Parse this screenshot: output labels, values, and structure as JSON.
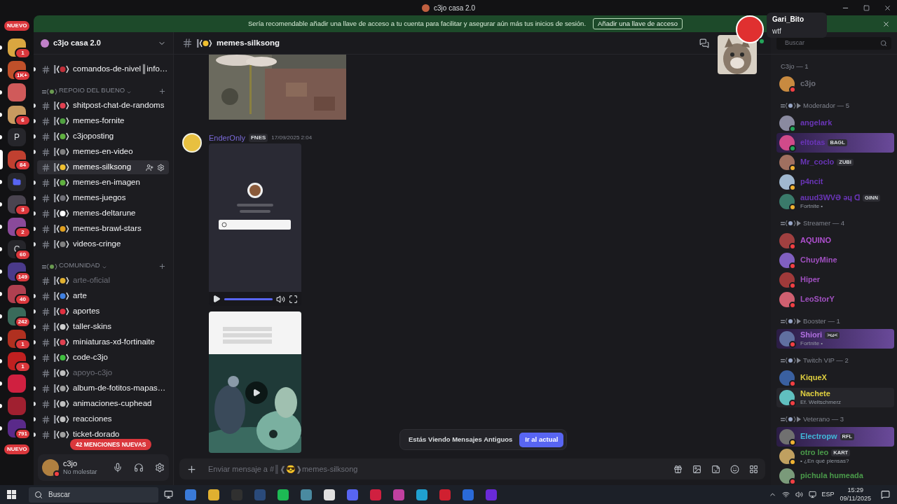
{
  "window": {
    "title": "c3jo casa 2.0"
  },
  "banner": {
    "text": "Sería recomendable añadir una llave de acceso a tu cuenta para facilitar y asegurar aún más tus inicios de sesión.",
    "action": "Añadir una llave de acceso"
  },
  "rail": {
    "top_pill": "NUEVO",
    "bottom_pill": "NUEVO",
    "servers": [
      {
        "kind": "icon",
        "color": "#d9a640",
        "badge": "1",
        "selected": false
      },
      {
        "kind": "icon",
        "color": "#c0502a",
        "badge": "1K+",
        "selected": false
      },
      {
        "kind": "icon",
        "color": "#d05a5a",
        "selected": false
      },
      {
        "kind": "icon",
        "color": "#c89a60",
        "badge": "6",
        "selected": false
      },
      {
        "kind": "letter",
        "letter": "P",
        "selected": false
      },
      {
        "kind": "icon",
        "color": "#c04030",
        "badge": "84",
        "selected": true
      },
      {
        "kind": "folder",
        "selected": false
      },
      {
        "kind": "icon",
        "color": "#4a4450",
        "badge": "3",
        "selected": false
      },
      {
        "kind": "icon",
        "color": "#8a4a9a",
        "badge": "2",
        "selected": false
      },
      {
        "kind": "letter",
        "letter": "C",
        "badge": "60",
        "selected": false
      },
      {
        "kind": "icon",
        "color": "#4a3a8a",
        "badge": "149",
        "selected": false
      },
      {
        "kind": "icon",
        "color": "#b04050",
        "badge": "40",
        "selected": false
      },
      {
        "kind": "icon",
        "color": "#3a6a5a",
        "badge": "242",
        "selected": false
      },
      {
        "kind": "icon",
        "color": "#b03020",
        "badge": "1",
        "selected": false
      },
      {
        "kind": "icon",
        "color": "#c02020",
        "badge": "1",
        "selected": false
      },
      {
        "kind": "icon",
        "color": "#d02040",
        "selected": false
      },
      {
        "kind": "icon",
        "color": "#a02030",
        "selected": false
      },
      {
        "kind": "icon",
        "color": "#5a2a8a",
        "badge": "791",
        "selected": false
      }
    ]
  },
  "server": {
    "name": "c3jo casa 2.0"
  },
  "channels": [
    {
      "kind": "channel",
      "name": "comandos-de-nivel║info…",
      "color": "#c0303a",
      "unread": true,
      "selected": false
    },
    {
      "kind": "category",
      "name": "REPOIO DEL BUENO"
    },
    {
      "kind": "channel",
      "name": "shitpost-chat-de-randoms",
      "color": "#e04050",
      "unread": true,
      "selected": false
    },
    {
      "kind": "channel",
      "name": "memes-fornite",
      "color": "#50a040",
      "unread": true,
      "selected": false
    },
    {
      "kind": "channel",
      "name": "c3joposting",
      "color": "#60b040",
      "unread": true,
      "selected": false
    },
    {
      "kind": "channel",
      "name": "memes-en-video",
      "color": "#808080",
      "unread": true,
      "selected": false
    },
    {
      "kind": "channel",
      "name": "memes-silksong",
      "color": "#f0c030",
      "unread": false,
      "selected": true
    },
    {
      "kind": "channel",
      "name": "memes-en-imagen",
      "color": "#60b040",
      "unread": true,
      "selected": false
    },
    {
      "kind": "channel",
      "name": "memes-juegos",
      "color": "#707078",
      "unread": true,
      "selected": false
    },
    {
      "kind": "channel",
      "name": "memes-deltarune",
      "color": "#ffffff",
      "unread": true,
      "selected": false
    },
    {
      "kind": "channel",
      "name": "memes-brawl-stars",
      "color": "#e0a020",
      "unread": true,
      "selected": false
    },
    {
      "kind": "channel",
      "name": "videos-cringe",
      "color": "#808080",
      "unread": true,
      "selected": false
    },
    {
      "kind": "category",
      "name": "COMUNIDAD"
    },
    {
      "kind": "channel",
      "name": "arte-oficial",
      "color": "#e0b030",
      "unread": false,
      "selected": false
    },
    {
      "kind": "channel",
      "name": "arte",
      "color": "#4080e0",
      "unread": true,
      "selected": false
    },
    {
      "kind": "channel",
      "name": "aportes",
      "color": "#e03040",
      "unread": true,
      "selected": false
    },
    {
      "kind": "channel",
      "name": "taller-skins",
      "color": "#d0d0d0",
      "unread": true,
      "selected": false
    },
    {
      "kind": "channel",
      "name": "miniaturas-xd-fortinaite",
      "color": "#e04050",
      "unread": true,
      "selected": false
    },
    {
      "kind": "channel",
      "name": "code-c3jo",
      "color": "#40c040",
      "unread": true,
      "selected": false
    },
    {
      "kind": "channel",
      "name": "apoyo-c3jo",
      "color": "#c0c0c0",
      "unread": false,
      "selected": false
    },
    {
      "kind": "channel",
      "name": "album-de-fotitos-mapas…",
      "color": "#a0a0a0",
      "unread": true,
      "selected": false
    },
    {
      "kind": "channel",
      "name": "animaciones-cuphead",
      "color": "#c0c0c0",
      "unread": true,
      "selected": false
    },
    {
      "kind": "channel",
      "name": "reacciones",
      "color": "#c0c0c0",
      "unread": true,
      "selected": false
    },
    {
      "kind": "channel",
      "name": "ticket-dorado",
      "color": "#a0a0a0",
      "unread": true,
      "selected": false
    }
  ],
  "mentions_pill": "42 MENCIONES NUEVAS",
  "user": {
    "name": "c3jo",
    "status": "No molestar"
  },
  "chat": {
    "channel": "memes-silksong",
    "message": {
      "author": "EnderOnly",
      "tag": "FNES",
      "time": "17/09/2025 2:04",
      "video": {
        "level": 1
      }
    },
    "toast": {
      "text": "Estás Viendo Mensajes Antiguos",
      "action": "Ir al actual"
    },
    "composer": {
      "placeholder": "Enviar mensaje a #║❰😎❱memes-silksong"
    }
  },
  "notification": {
    "author": "Gari_Bito",
    "text": "wtf"
  },
  "members": {
    "search": {
      "placeholder": "Buscar"
    },
    "groups": [
      {
        "title": "C3jo — 1",
        "decorated": false,
        "members": [
          {
            "name": "c3jo",
            "color": "#6d6f78",
            "kind": "dnd"
          }
        ]
      },
      {
        "title": "Moderador — 5",
        "decorated": true,
        "members": [
          {
            "name": "angelark",
            "color": "#6a35b8",
            "kind": "mobile"
          },
          {
            "name": "eltotas",
            "color": "#6a35b8",
            "kind": "online",
            "tag": "BAGL",
            "banner": true
          },
          {
            "name": "Mr_coclo",
            "color": "#6a35b8",
            "kind": "idle",
            "tag": "ZUBI"
          },
          {
            "name": "p4ncit",
            "color": "#6a35b8",
            "kind": "idle"
          },
          {
            "name": "auud3WVƏ ǝɥ ᗡ",
            "color": "#6a35b8",
            "kind": "idle",
            "tag": "GINN",
            "activity": "Fortnite •"
          }
        ]
      },
      {
        "title": "Streamer — 4",
        "decorated": true,
        "members": [
          {
            "name": "AQUINO",
            "color": "#b050d0",
            "kind": "dnd"
          },
          {
            "name": "ChuyMine",
            "color": "#a050c0",
            "kind": "dnd"
          },
          {
            "name": "Hiper",
            "color": "#a050c0",
            "kind": "dnd"
          },
          {
            "name": "LeoStorY",
            "color": "#a050c0",
            "kind": "dnd"
          }
        ]
      },
      {
        "title": "Booster — 1",
        "decorated": true,
        "members": [
          {
            "name": "Shiori",
            "color": "#b070e0",
            "kind": "dnd",
            "tag": ">ω<",
            "activity": "Fortnite •",
            "banner": true
          }
        ]
      },
      {
        "title": "Twitch VIP — 2",
        "decorated": true,
        "members": [
          {
            "name": "KiqueX",
            "color": "#e0d040",
            "kind": "dnd"
          },
          {
            "name": "Nachete",
            "color": "#e0d040",
            "kind": "dnd",
            "activity": "Ef. Weltschmerz",
            "hovered": true
          }
        ]
      },
      {
        "title": "Veterano — 3",
        "decorated": true,
        "members": [
          {
            "name": "Electropw",
            "color": "#40b8d8",
            "kind": "idle",
            "tag": "RFL",
            "banner": true
          },
          {
            "name": "otro leo",
            "color": "#4a9a4a",
            "kind": "idle",
            "tag": "KART",
            "activity": "• ¿En qué piensas?"
          },
          {
            "name": "pichula humeada",
            "color": "#4a9a4a",
            "kind": "dnd"
          }
        ]
      }
    ]
  },
  "taskbar": {
    "search": {
      "placeholder": "Buscar"
    },
    "language": "ESP",
    "time": "15:29",
    "date": "09/11/2025"
  }
}
